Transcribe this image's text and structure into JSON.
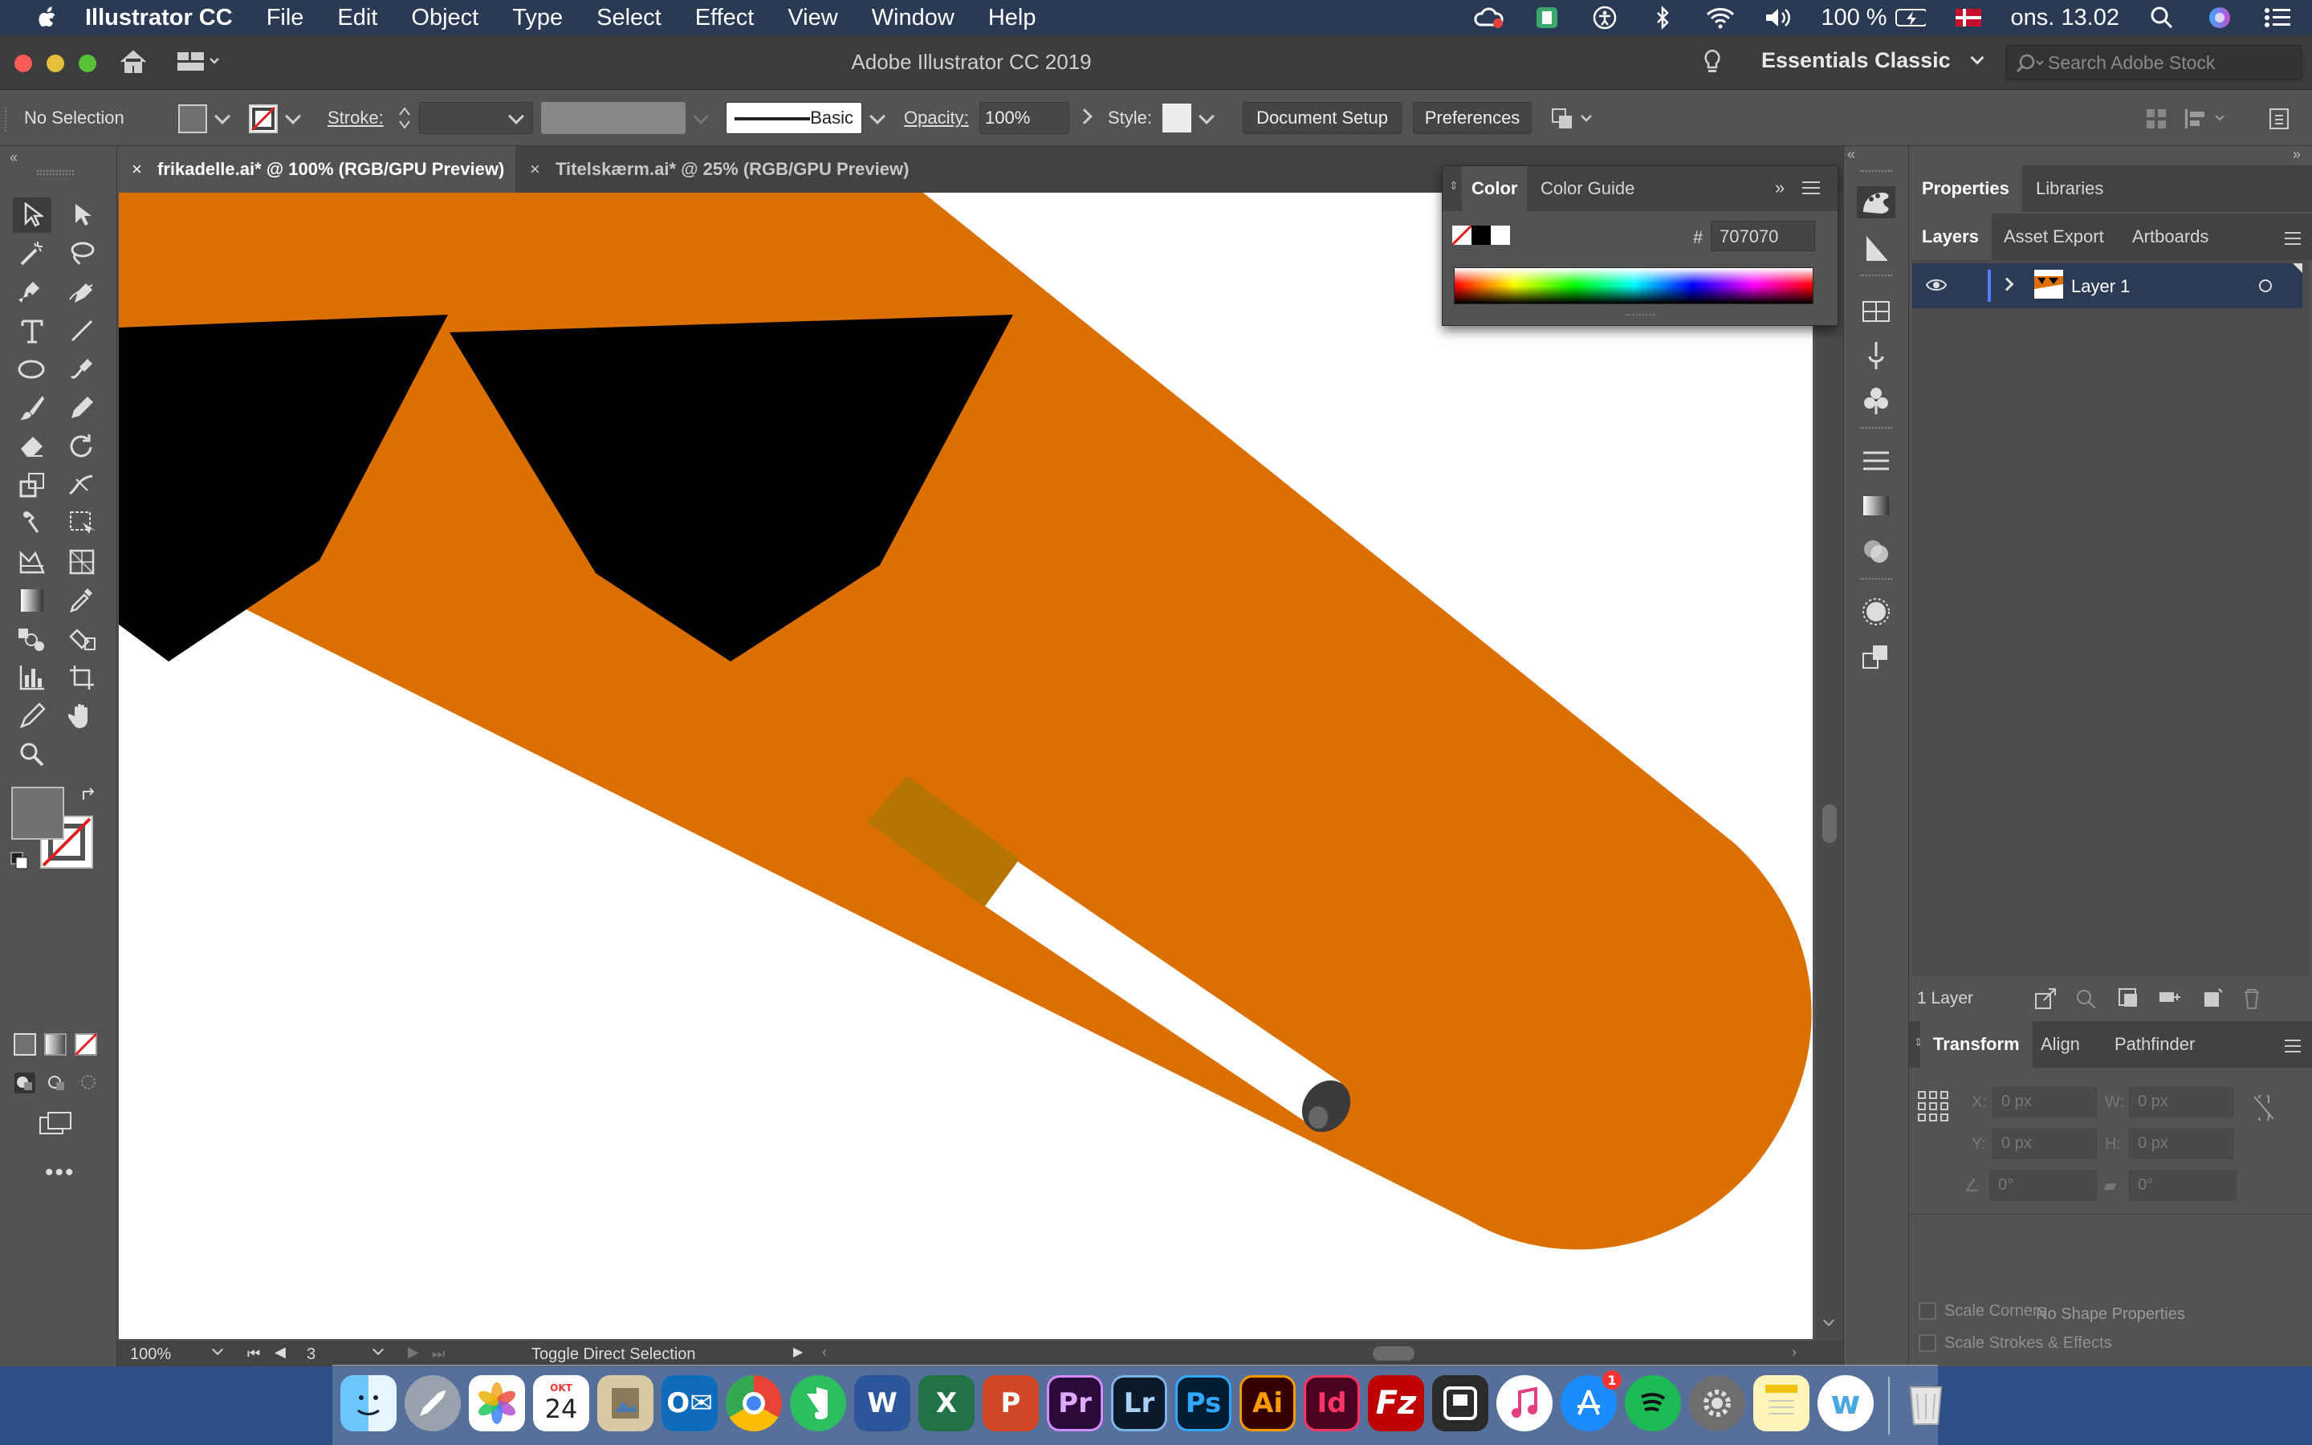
{
  "menubar": {
    "app_name": "Illustrator CC",
    "menus": [
      "File",
      "Edit",
      "Object",
      "Type",
      "Select",
      "Effect",
      "View",
      "Window",
      "Help"
    ],
    "battery": "100 %",
    "date": "ons. 13.02"
  },
  "window": {
    "title": "Adobe Illustrator CC 2019",
    "workspace": "Essentials Classic",
    "search_placeholder": "Search Adobe Stock"
  },
  "control_bar": {
    "selection_label": "No Selection",
    "stroke_label": "Stroke:",
    "brush_label": "Basic",
    "opacity_label": "Opacity:",
    "opacity_value": "100%",
    "style_label": "Style:",
    "document_setup": "Document Setup",
    "preferences": "Preferences"
  },
  "tabs": [
    {
      "label": "frikadelle.ai* @ 100% (RGB/GPU Preview)",
      "active": true
    },
    {
      "label": "Titelskærm.ai* @ 25% (RGB/GPU Preview)",
      "active": false
    }
  ],
  "color_panel": {
    "tab_color": "Color",
    "tab_guide": "Color Guide",
    "hash": "#",
    "hex_value": "707070"
  },
  "properties_panel": {
    "tabs": [
      "Properties",
      "Libraries"
    ]
  },
  "layers_panel": {
    "tabs": [
      "Layers",
      "Asset Export",
      "Artboards"
    ],
    "layer_name": "Layer 1",
    "layer_count": "1 Layer"
  },
  "transform_panel": {
    "tabs": [
      "Transform",
      "Align",
      "Pathfinder"
    ],
    "x_label": "X:",
    "y_label": "Y:",
    "w_label": "W:",
    "h_label": "H:",
    "x_value": "0 px",
    "y_value": "0 px",
    "w_value": "0 px",
    "h_value": "0 px",
    "angle_value": "0°",
    "shear_value": "0°",
    "empty_message": "No Shape Properties",
    "scale_corners": "Scale Corners",
    "scale_strokes": "Scale Strokes & Effects"
  },
  "status_bar": {
    "zoom": "100%",
    "artboard_number": "3",
    "tool_status": "Toggle Direct Selection"
  },
  "dock": {
    "calendar_month": "OKT",
    "calendar_day": "24",
    "appstore_badge": "1",
    "apps": [
      "Finder",
      "Launchpad",
      "Photos",
      "Calendar",
      "Preview",
      "Outlook",
      "Chrome",
      "Evernote",
      "Word",
      "Excel",
      "PowerPoint",
      "Premiere Pro",
      "Lightroom",
      "Photoshop",
      "Illustrator",
      "InDesign",
      "FileZilla",
      "Screen",
      "iTunes",
      "App Store",
      "Spotify",
      "System Preferences",
      "Notes",
      "Webflow",
      "Trash"
    ],
    "labels": {
      "pr": "Pr",
      "lr": "Lr",
      "ps": "Ps",
      "ai": "Ai",
      "id": "Id"
    }
  },
  "colors": {
    "artwork_orange": "#DB7000",
    "artwork_black": "#000000",
    "artwork_brown": "#B87400",
    "selection_blue": "#2b3b55",
    "fill_gray": "#707070"
  }
}
